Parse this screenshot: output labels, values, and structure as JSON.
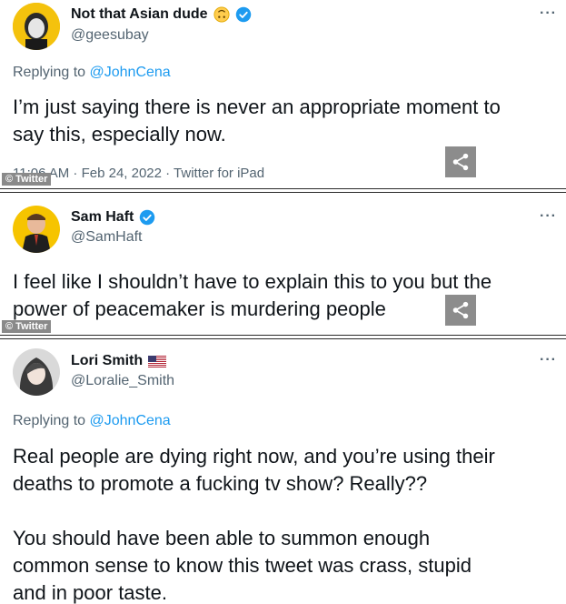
{
  "tweets": [
    {
      "name": "Not that Asian dude",
      "handle": "@geesubay",
      "more": "···",
      "replying_prefix": "Replying to",
      "replying_to": "@JohnCena",
      "text_line1": "I’m just saying there is never an appropriate moment to",
      "text_line2": "say this, especially now.",
      "meta": "11:06 AM · Feb 24, 2022 · Twitter for iPad",
      "watermark": "© Twitter",
      "emoji_icon": "upside-down-face-icon"
    },
    {
      "name": "Sam Haft",
      "handle": "@SamHaft",
      "more": "···",
      "text_line1": "I feel like I shouldn’t have to explain this to you but the",
      "text_line2": "power of peacemaker is murdering people",
      "watermark": "© Twitter"
    },
    {
      "name": "Lori Smith",
      "handle": "@Loralie_Smith",
      "more": "···",
      "replying_prefix": "Replying to",
      "replying_to": "@JohnCena",
      "text_line1": "Real people are dying right now, and you’re using their",
      "text_line2": "deaths to promote a fucking tv show? Really??",
      "text_line3": "You should have been able to summon enough",
      "text_line4": "common sense to know this tweet was crass, stupid",
      "text_line5": "and in poor taste.",
      "flag_icon": "us-flag-icon"
    }
  ],
  "colors": {
    "verified": "#1d9bf0",
    "mention": "#1d9bf0",
    "secondary_text": "#536471"
  }
}
